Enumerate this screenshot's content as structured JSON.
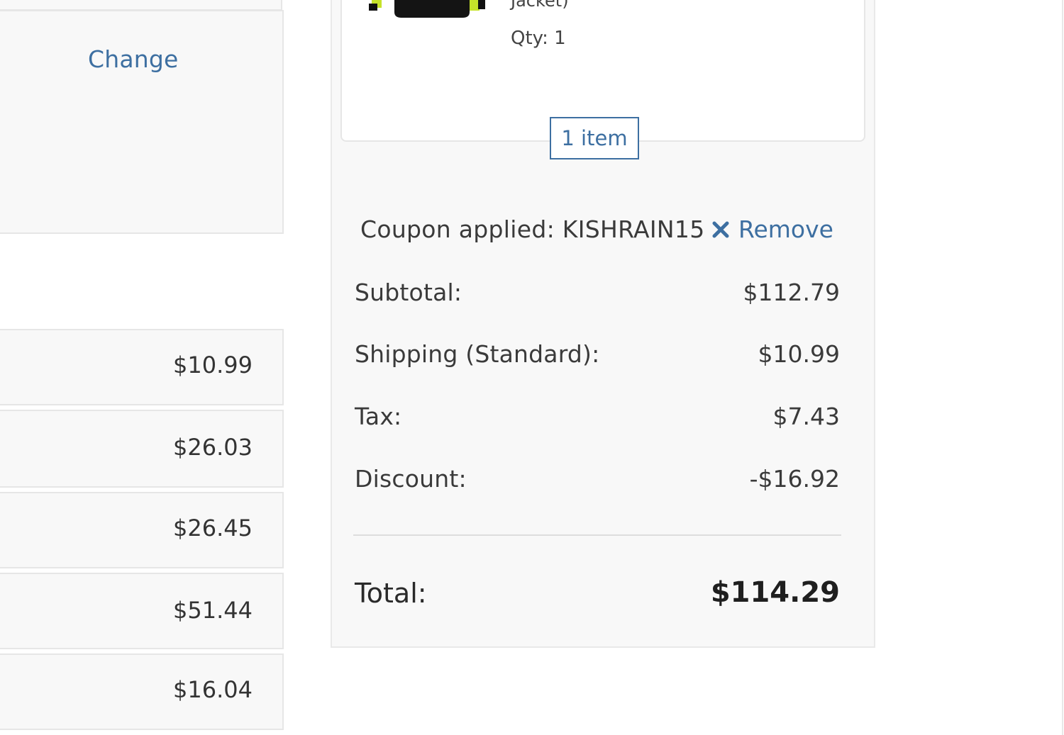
{
  "left_panel": {
    "change_label": "Change",
    "shipping_options": [
      {
        "price": "$10.99"
      },
      {
        "price": "$26.03"
      },
      {
        "price": "$26.45"
      },
      {
        "price": "$51.44"
      },
      {
        "price": "$16.04"
      }
    ]
  },
  "order_summary": {
    "cart_item": {
      "name_tail": "Jacket)",
      "qty": "Qty: 1",
      "thumbnail": "jacket-thumbnail"
    },
    "item_count": "1 item",
    "coupon": {
      "text": "Coupon applied: KISHRAIN15",
      "remove_label": "Remove",
      "remove_icon": "close-icon"
    },
    "rows": [
      {
        "label": "Subtotal:",
        "value": "$112.79"
      },
      {
        "label": "Shipping (Standard):",
        "value": "$10.99"
      },
      {
        "label": "Tax:",
        "value": "$7.43"
      },
      {
        "label": "Discount:",
        "value": "-$16.92"
      }
    ],
    "total": {
      "label": "Total:",
      "value": "$114.29"
    }
  },
  "colors": {
    "link": "#3d6fa1",
    "panel_bg": "#f8f8f8",
    "border": "#e6e6e6",
    "product_accent": "#c6e22a"
  }
}
